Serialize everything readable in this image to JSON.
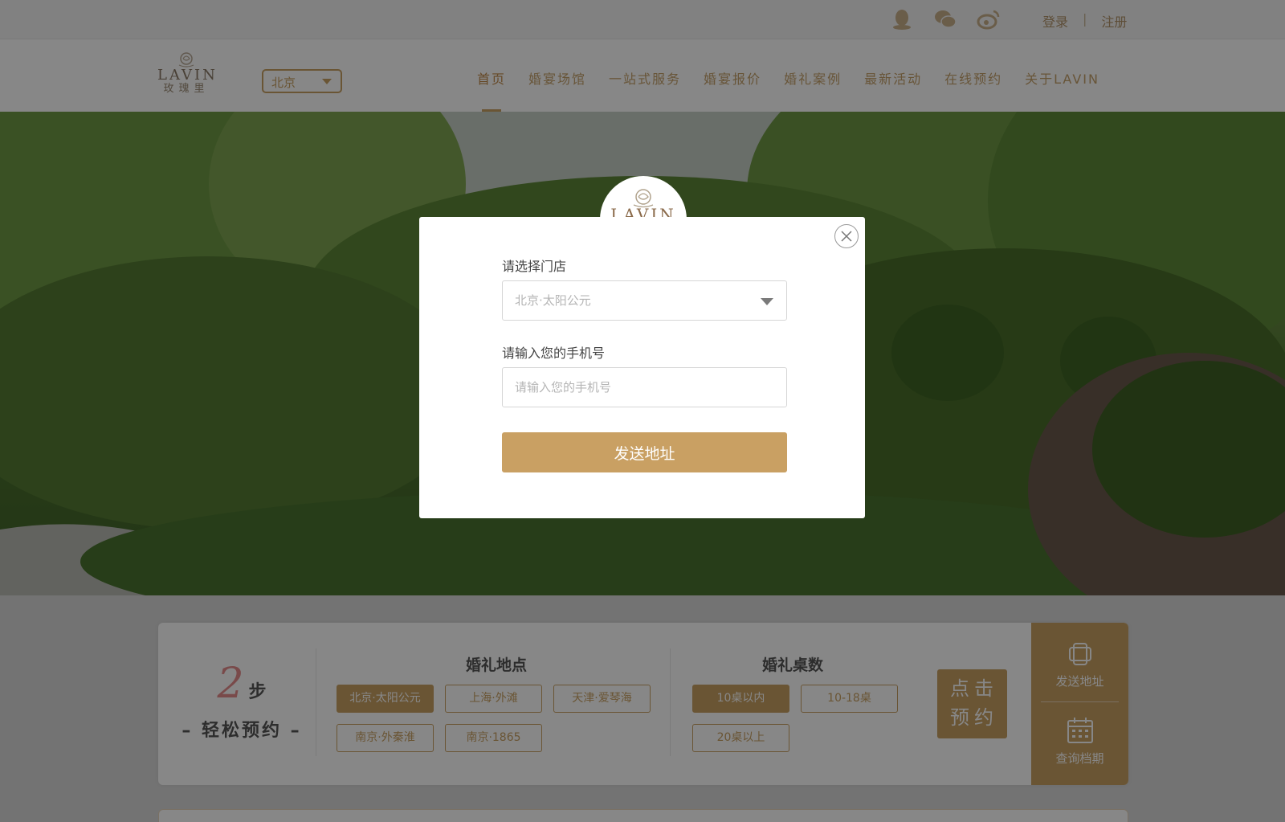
{
  "topbar": {
    "icons": [
      "qq-icon",
      "wechat-icon",
      "weibo-icon"
    ],
    "login": "登录",
    "separator": "|",
    "register": "注册"
  },
  "header": {
    "logo_brand": "LAVIN",
    "logo_sub": "玫瑰里",
    "city": "北京",
    "nav": [
      "首页",
      "婚宴场馆",
      "一站式服务",
      "婚宴报价",
      "婚礼案例",
      "最新活动",
      "在线预约",
      "关于LAVIN"
    ],
    "active_nav_index": 0
  },
  "booking": {
    "step_number": "2",
    "step_unit": "步",
    "step_caption": "– 轻松预约 –",
    "venue_title": "婚礼地点",
    "venues": [
      "北京·太阳公元",
      "上海·外滩",
      "天津·爱琴海",
      "南京·外秦淮",
      "南京·1865"
    ],
    "selected_venue_index": 0,
    "tables_title": "婚礼桌数",
    "tables": [
      "10桌以内",
      "10-18桌",
      "20桌以上"
    ],
    "selected_tables_index": 0,
    "book_button": "点击预约",
    "side_send": "发送地址",
    "side_check": "查询档期"
  },
  "modal": {
    "badge_brand": "LAVIN",
    "store_label": "请选择门店",
    "store_value": "北京·太阳公元",
    "phone_label": "请输入您的手机号",
    "phone_placeholder": "请输入您的手机号",
    "submit": "发送地址"
  },
  "colors": {
    "accent": "#c9a063",
    "step_number": "#e58c8c",
    "overlay": "rgba(0,0,0,0.47)"
  }
}
